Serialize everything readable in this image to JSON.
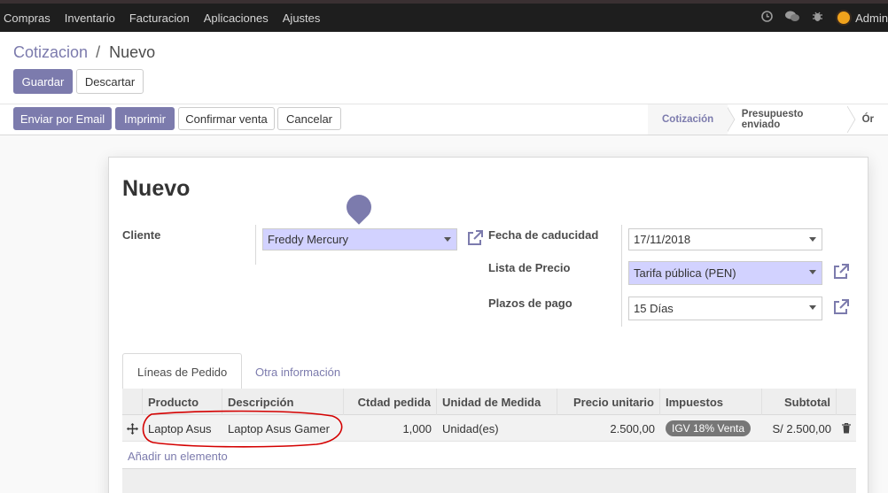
{
  "topbar": {
    "menu": [
      "Compras",
      "Inventario",
      "Facturacion",
      "Aplicaciones",
      "Ajustes"
    ],
    "user": "Admin",
    "icons": [
      "clock-icon",
      "chat-icon",
      "bug-icon",
      "avatar"
    ]
  },
  "breadcrumb": {
    "parent": "Cotizacion",
    "separator": "/",
    "current": "Nuevo"
  },
  "buttons": {
    "save": "Guardar",
    "discard": "Descartar",
    "email": "Enviar por Email",
    "print": "Imprimir",
    "confirm": "Confirmar venta",
    "cancel": "Cancelar"
  },
  "status_stages": [
    "Cotización",
    "Presupuesto enviado",
    "Ór"
  ],
  "form": {
    "title": "Nuevo",
    "customer_label": "Cliente",
    "customer_value": "Freddy Mercury",
    "expiration_label": "Fecha de caducidad",
    "expiration_value": "17/11/2018",
    "pricelist_label": "Lista de Precio",
    "pricelist_value": "Tarifa pública (PEN)",
    "payment_terms_label": "Plazos de pago",
    "payment_terms_value": "15 Días"
  },
  "tabs": [
    "Líneas de Pedido",
    "Otra información"
  ],
  "order_lines": {
    "columns": [
      "Producto",
      "Descripción",
      "Ctdad pedida",
      "Unidad de Medida",
      "Precio unitario",
      "Impuestos",
      "Subtotal"
    ],
    "rows": [
      {
        "product": "Laptop Asus",
        "description": "Laptop Asus Gamer",
        "qty": "1,000",
        "uom": "Unidad(es)",
        "price": "2.500,00",
        "tax": "IGV 18% Venta",
        "subtotal": "S/ 2.500,00"
      }
    ],
    "add_line": "Añadir un elemento"
  },
  "colors": {
    "primary": "#7c7bad",
    "required_field": "#d2d2ff",
    "annotation": "#d40000"
  }
}
